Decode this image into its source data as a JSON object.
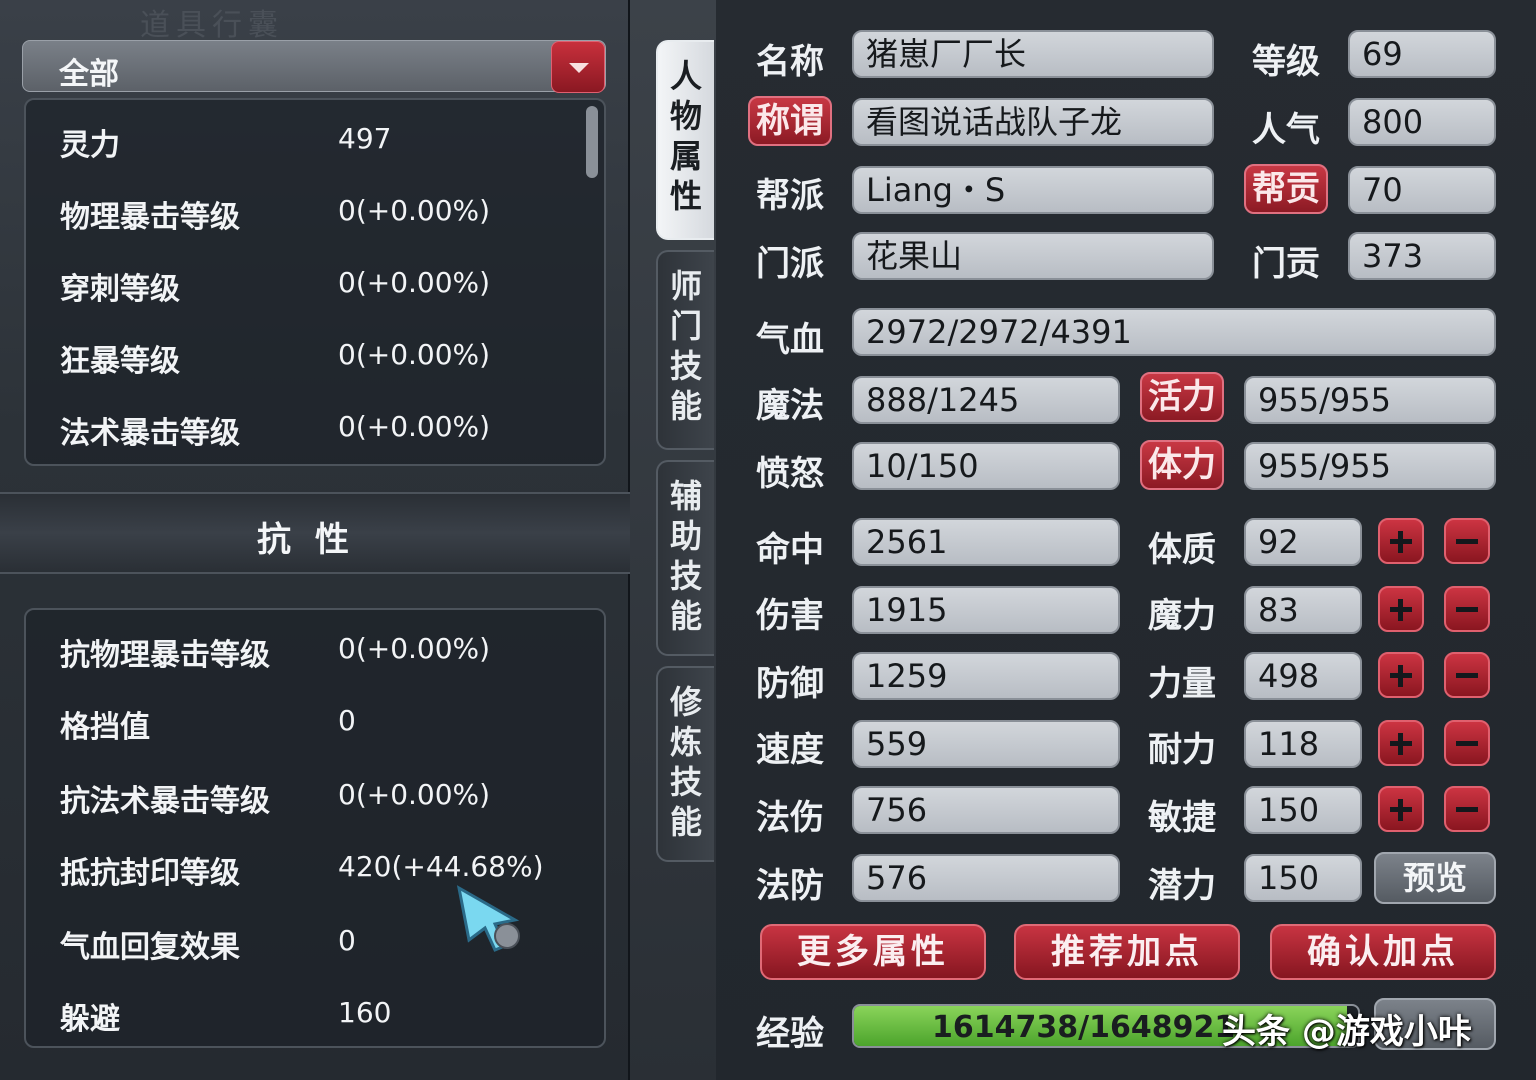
{
  "left": {
    "bg_title": "道具行囊",
    "filter": "全部",
    "top_stats": [
      {
        "label": "灵力",
        "value": "497"
      },
      {
        "label": "物理暴击等级",
        "value": "0(+0.00%)"
      },
      {
        "label": "穿刺等级",
        "value": "0(+0.00%)"
      },
      {
        "label": "狂暴等级",
        "value": "0(+0.00%)"
      },
      {
        "label": "法术暴击等级",
        "value": "0(+0.00%)"
      }
    ],
    "section_title": "抗性",
    "resist_stats": [
      {
        "label": "抗物理暴击等级",
        "value": "0(+0.00%)"
      },
      {
        "label": "格挡值",
        "value": "0"
      },
      {
        "label": "抗法术暴击等级",
        "value": "0(+0.00%)"
      },
      {
        "label": "抵抗封印等级",
        "value": "420(+44.68%)"
      },
      {
        "label": "气血回复效果",
        "value": "0"
      },
      {
        "label": "躲避",
        "value": "160"
      }
    ]
  },
  "tabs": [
    {
      "label": "人物属性",
      "active": true
    },
    {
      "label": "师门技能",
      "active": false
    },
    {
      "label": "辅助技能",
      "active": false
    },
    {
      "label": "修炼技能",
      "active": false
    }
  ],
  "profile": {
    "name_label": "名称",
    "name": "猪崽厂厂长",
    "level_label": "等级",
    "level": "69",
    "title_label": "称谓",
    "title": "看图说话战队子龙",
    "popularity_label": "人气",
    "popularity": "800",
    "guild_label": "帮派",
    "guild": "Liang・S",
    "guild_contrib_label": "帮贡",
    "guild_contrib": "70",
    "school_label": "门派",
    "school": "花果山",
    "school_contrib_label": "门贡",
    "school_contrib": "373"
  },
  "vitals": {
    "hp_label": "气血",
    "hp": "2972/2972/4391",
    "mp_label": "魔法",
    "mp": "888/1245",
    "vitality_label": "活力",
    "vitality": "955/955",
    "anger_label": "愤怒",
    "anger": "10/150",
    "stamina_label": "体力",
    "stamina": "955/955"
  },
  "combat": [
    {
      "label": "命中",
      "value": "2561"
    },
    {
      "label": "伤害",
      "value": "1915"
    },
    {
      "label": "防御",
      "value": "1259"
    },
    {
      "label": "速度",
      "value": "559"
    },
    {
      "label": "法伤",
      "value": "756"
    },
    {
      "label": "法防",
      "value": "576"
    }
  ],
  "attributes": [
    {
      "label": "体质",
      "value": "92"
    },
    {
      "label": "魔力",
      "value": "83"
    },
    {
      "label": "力量",
      "value": "498"
    },
    {
      "label": "耐力",
      "value": "118"
    },
    {
      "label": "敏捷",
      "value": "150"
    },
    {
      "label": "潜力",
      "value": "150"
    }
  ],
  "buttons": {
    "preview": "预览",
    "more": "更多属性",
    "recommend": "推荐加点",
    "confirm": "确认加点"
  },
  "exp": {
    "label": "经验",
    "text": "1614738/1648921",
    "progress": 0.979
  },
  "watermark": "头条 @游戏小咔",
  "colors": {
    "accent_red": "#c83442",
    "field_bg": "#c8ccd1",
    "exp_green": "#5cb43a"
  }
}
